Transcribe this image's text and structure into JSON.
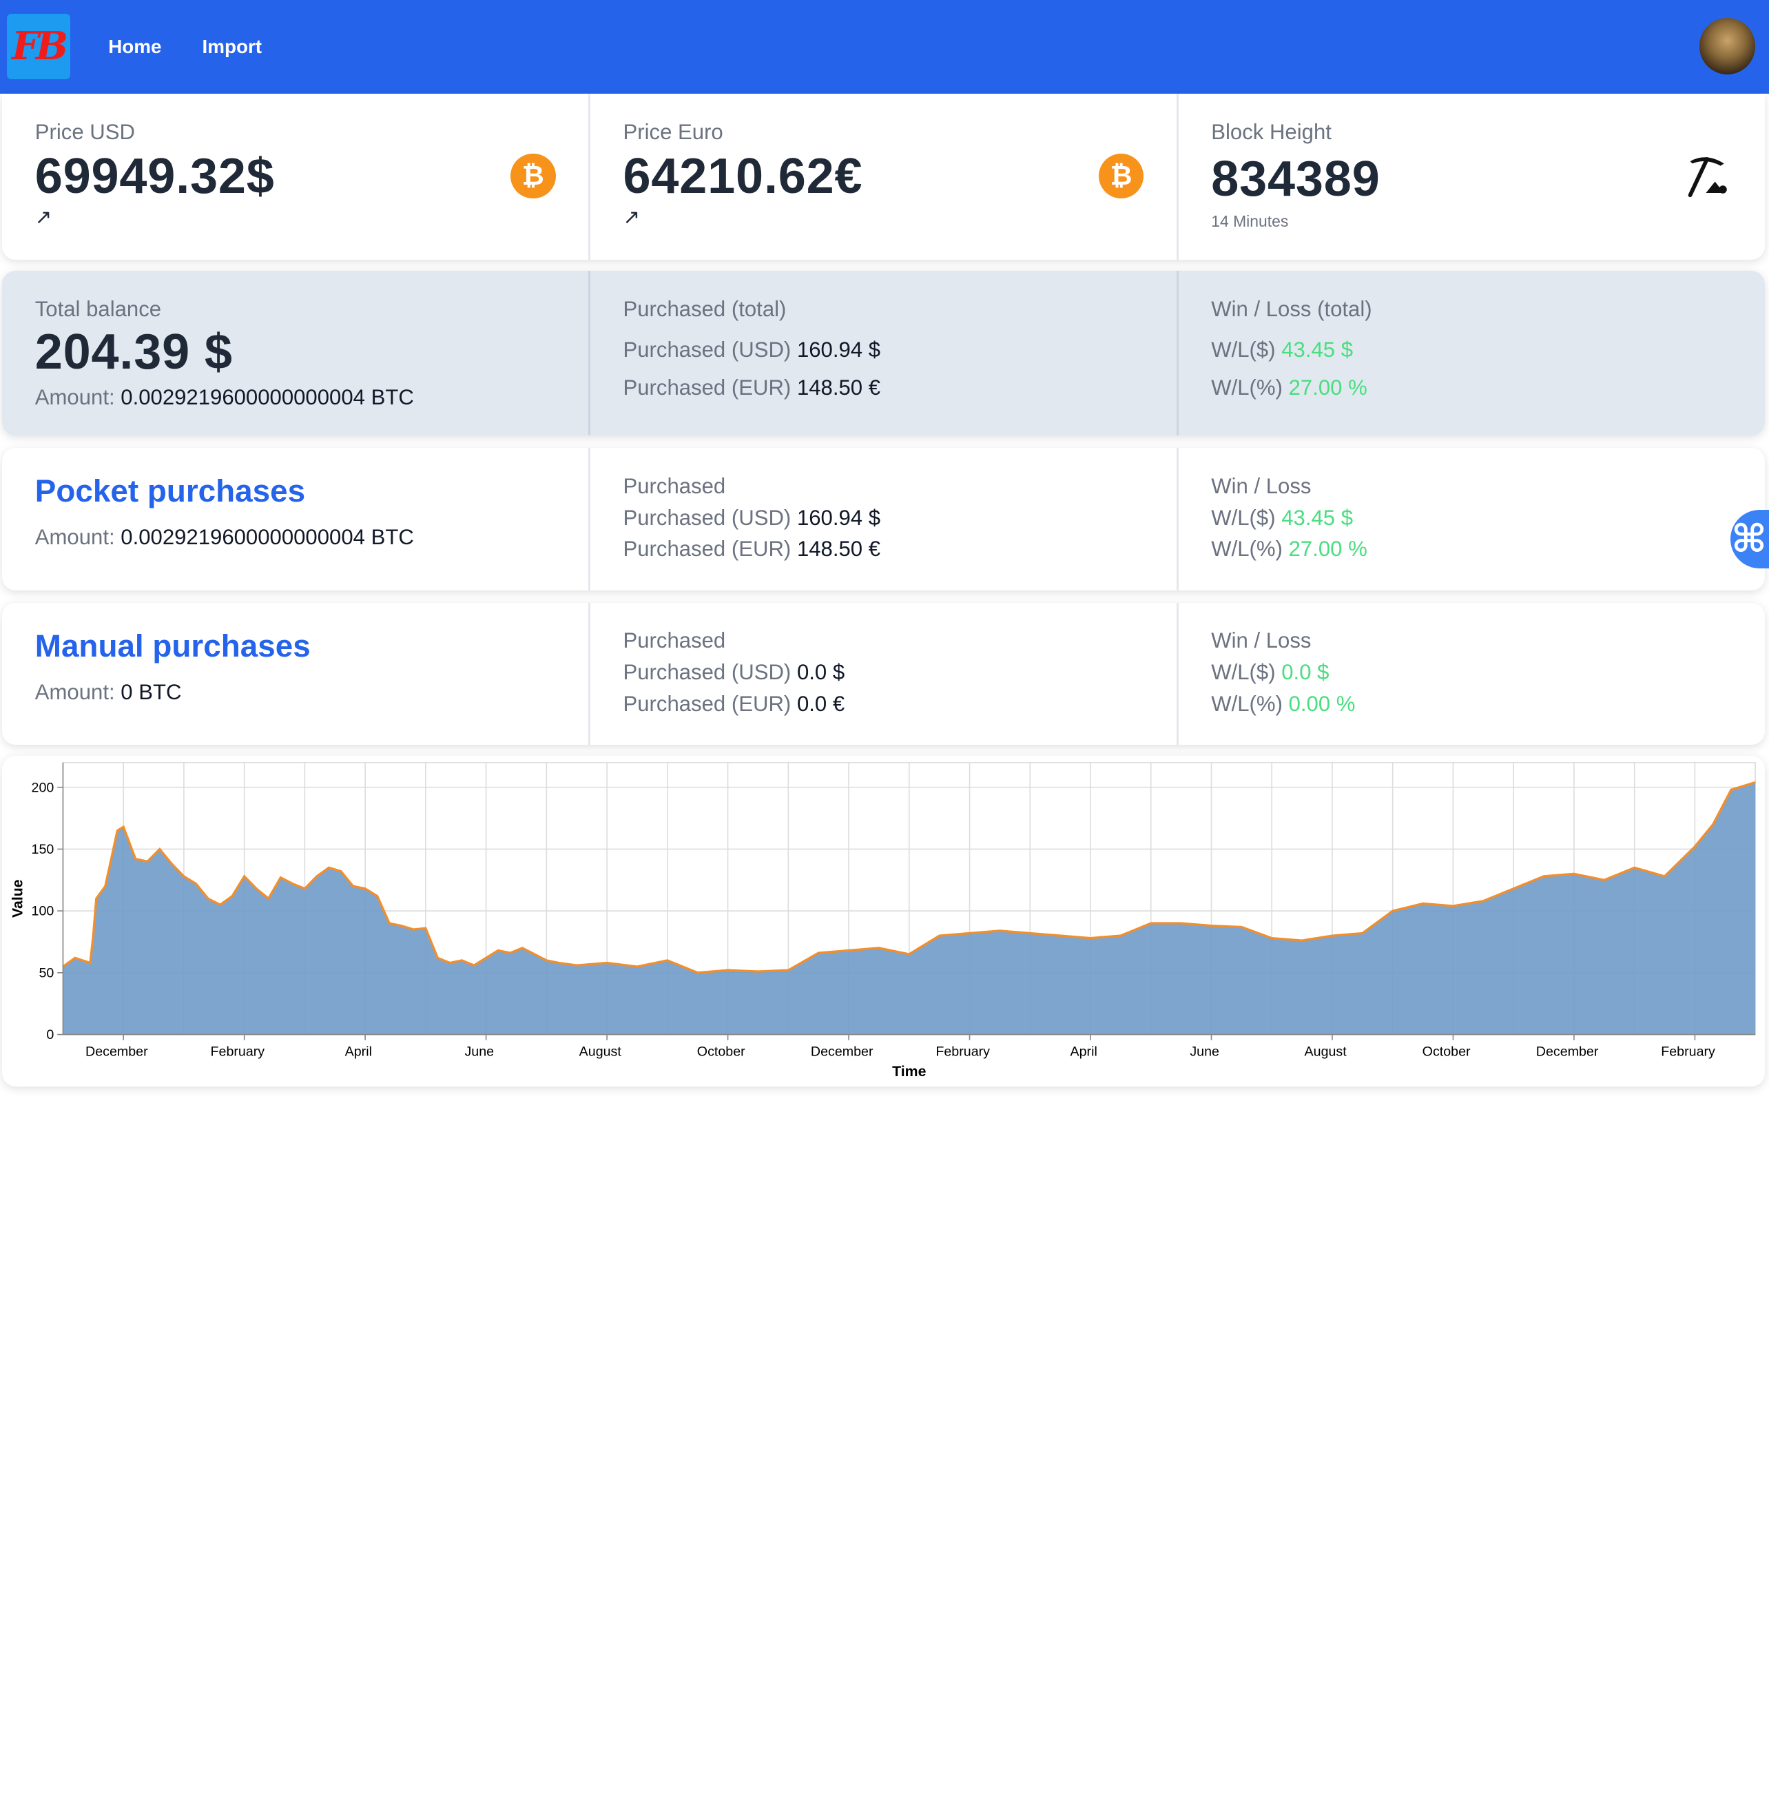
{
  "nav": {
    "logo_text": "FB",
    "links": [
      "Home",
      "Import"
    ]
  },
  "prices": [
    {
      "title": "Price USD",
      "value": "69949.32$",
      "trend": "↗",
      "icon": "bitcoin-icon"
    },
    {
      "title": "Price Euro",
      "value": "64210.62€",
      "trend": "↗",
      "icon": "bitcoin-icon"
    },
    {
      "title": "Block Height",
      "value": "834389",
      "desc": "14 Minutes",
      "icon": "pickaxe-icon"
    }
  ],
  "total": {
    "balance_title": "Total balance",
    "balance_value": "204.39 $",
    "amount_label": "Amount:",
    "amount_value": "0.0029219600000000004 BTC",
    "purchased_title": "Purchased (total)",
    "usd_label": "Purchased (USD)",
    "usd_value": "160.94 $",
    "eur_label": "Purchased (EUR)",
    "eur_value": "148.50 €",
    "wl_title": "Win / Loss (total)",
    "wl_usd_label": "W/L($)",
    "wl_usd_value": "43.45 $",
    "wl_pct_label": "W/L(%)",
    "wl_pct_value": "27.00 %"
  },
  "pocket": {
    "title": "Pocket purchases",
    "amount_label": "Amount:",
    "amount_value": "0.0029219600000000004 BTC",
    "purchased_title": "Purchased",
    "usd_label": "Purchased (USD)",
    "usd_value": "160.94 $",
    "eur_label": "Purchased (EUR)",
    "eur_value": "148.50 €",
    "wl_title": "Win / Loss",
    "wl_usd_label": "W/L($)",
    "wl_usd_value": "43.45 $",
    "wl_pct_label": "W/L(%)",
    "wl_pct_value": "27.00 %"
  },
  "manual": {
    "title": "Manual purchases",
    "amount_label": "Amount:",
    "amount_value": "0 BTC",
    "purchased_title": "Purchased",
    "usd_label": "Purchased (USD)",
    "usd_value": "0.0 $",
    "eur_label": "Purchased (EUR)",
    "eur_value": "0.0 €",
    "wl_title": "Win / Loss",
    "wl_usd_label": "W/L($)",
    "wl_usd_value": "0.0 $",
    "wl_pct_label": "W/L(%)",
    "wl_pct_value": "0.00 %"
  },
  "side_button": {
    "icon": "command-icon",
    "glyph": "⌘"
  },
  "colors": {
    "nav": "#2563eb",
    "accent": "#2563eb",
    "positive": "#4ade80",
    "btc": "#f7931a",
    "area_fill": "#6f9bc8",
    "area_line": "#f28e2b"
  },
  "chart_data": {
    "type": "area",
    "xlabel": "Time",
    "ylabel": "Value",
    "ylim": [
      0,
      220
    ],
    "yticks": [
      0,
      50,
      100,
      150,
      200
    ],
    "xtick_labels": [
      "December",
      "February",
      "April",
      "June",
      "August",
      "October",
      "December",
      "February",
      "April",
      "June",
      "August",
      "October",
      "December",
      "February"
    ],
    "grid": true,
    "x_range": [
      0,
      28
    ],
    "x_unit": "months",
    "x": [
      0,
      0.2,
      0.45,
      0.5,
      0.55,
      0.7,
      0.9,
      1.0,
      1.2,
      1.4,
      1.6,
      1.8,
      2.0,
      2.2,
      2.4,
      2.6,
      2.8,
      3.0,
      3.2,
      3.4,
      3.6,
      3.8,
      4.0,
      4.2,
      4.4,
      4.6,
      4.8,
      5.0,
      5.2,
      5.4,
      5.6,
      5.8,
      6.0,
      6.2,
      6.4,
      6.6,
      6.8,
      7.0,
      7.2,
      7.4,
      7.6,
      7.8,
      8.0,
      8.2,
      8.5,
      9.0,
      9.5,
      10.0,
      10.5,
      11.0,
      11.5,
      12.0,
      12.5,
      13.0,
      13.5,
      14.0,
      14.5,
      15.0,
      15.5,
      16.0,
      16.5,
      17.0,
      17.5,
      18.0,
      18.5,
      19.0,
      19.5,
      20.0,
      20.5,
      21.0,
      21.5,
      22.0,
      22.5,
      23.0,
      23.5,
      24.0,
      24.5,
      25.0,
      25.5,
      26.0,
      26.5,
      27.0,
      27.3,
      27.6,
      28.0
    ],
    "values": [
      55,
      62,
      58,
      80,
      110,
      120,
      165,
      168,
      142,
      140,
      150,
      138,
      128,
      122,
      110,
      105,
      112,
      128,
      118,
      110,
      127,
      122,
      118,
      128,
      135,
      132,
      120,
      118,
      112,
      90,
      88,
      85,
      86,
      62,
      58,
      60,
      56,
      62,
      68,
      66,
      70,
      65,
      60,
      58,
      56,
      58,
      55,
      60,
      50,
      52,
      51,
      52,
      66,
      68,
      70,
      65,
      80,
      82,
      84,
      82,
      80,
      78,
      80,
      90,
      90,
      88,
      87,
      78,
      76,
      80,
      82,
      100,
      106,
      104,
      108,
      118,
      128,
      130,
      125,
      135,
      128,
      152,
      170,
      198,
      204
    ]
  }
}
